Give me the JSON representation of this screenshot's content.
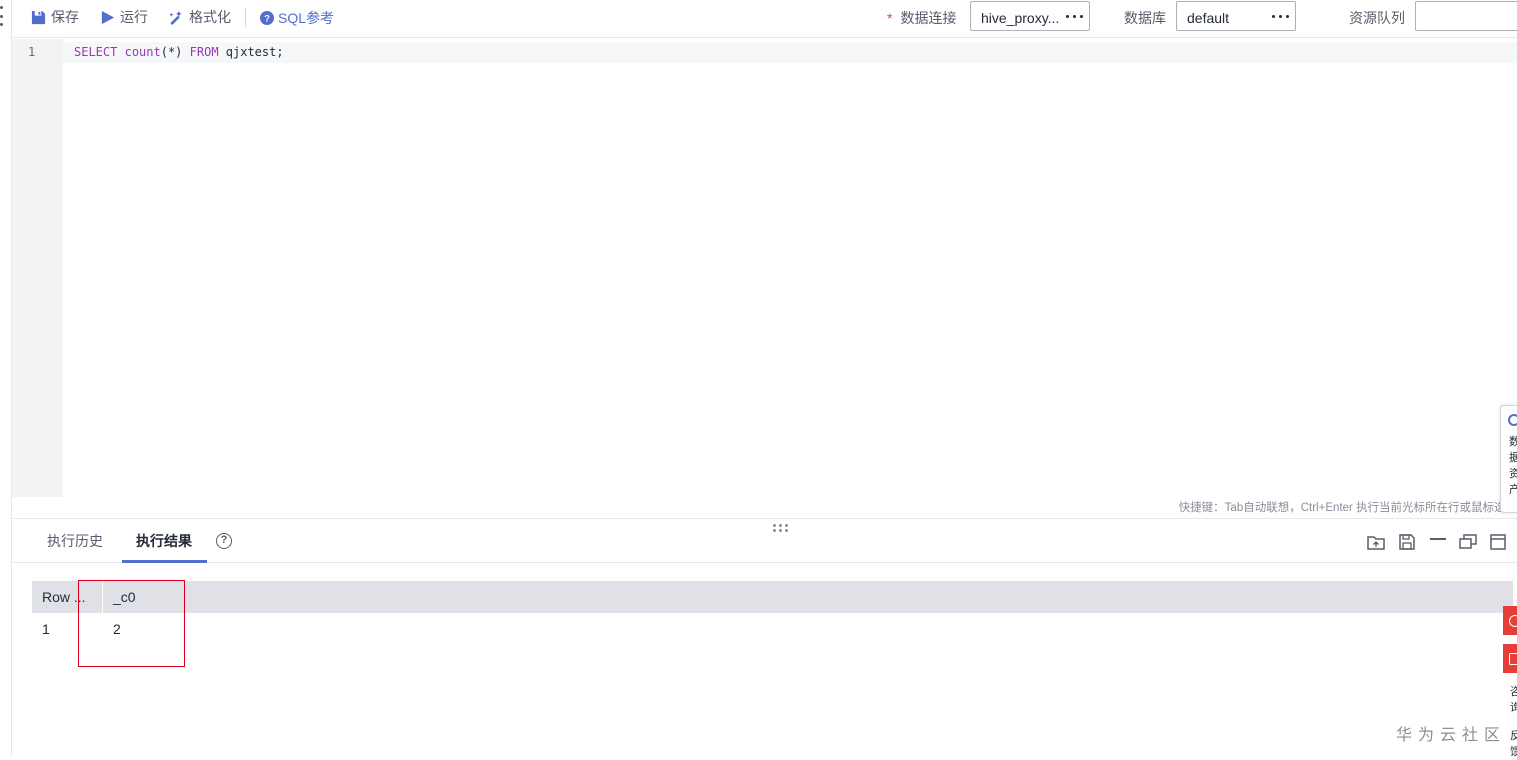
{
  "toolbar": {
    "save_label": "保存",
    "run_label": "运行",
    "format_label": "格式化",
    "sql_ref_label": "SQL参考",
    "required_mark": "*",
    "connection_label": "数据连接",
    "connection_value": "hive_proxy...",
    "database_label": "数据库",
    "database_value": "default",
    "queue_label": "资源队列",
    "queue_value": ""
  },
  "editor": {
    "line_number": "1",
    "code": {
      "kw_select": "SELECT",
      "fn_count": "count",
      "args": "(*)",
      "kw_from": "FROM",
      "table": "qjxtest;"
    },
    "shortcut_hint": "快捷键：Tab自动联想，Ctrl+Enter 执行当前光标所在行或鼠标选中"
  },
  "result_panel": {
    "tabs": [
      {
        "label": "执行历史",
        "active": false
      },
      {
        "label": "执行结果",
        "active": true
      }
    ],
    "help_glyph": "?",
    "columns": [
      "Row ...",
      "_c0"
    ],
    "rows": [
      [
        "1",
        "2"
      ]
    ],
    "icons": [
      "open-folder-icon",
      "save-icon",
      "minimize-icon",
      "restore-icon",
      "maximize-icon"
    ]
  },
  "side_panel": {
    "text": "数据资产"
  },
  "side_snippets": {
    "a": "咨询",
    "b": "反馈"
  },
  "watermark": "华为云社区",
  "colors": {
    "accent": "#526ecc",
    "highlight_box": "#d9001b",
    "keyword": "#9b36b7",
    "table_header": "#dfe1e6"
  }
}
